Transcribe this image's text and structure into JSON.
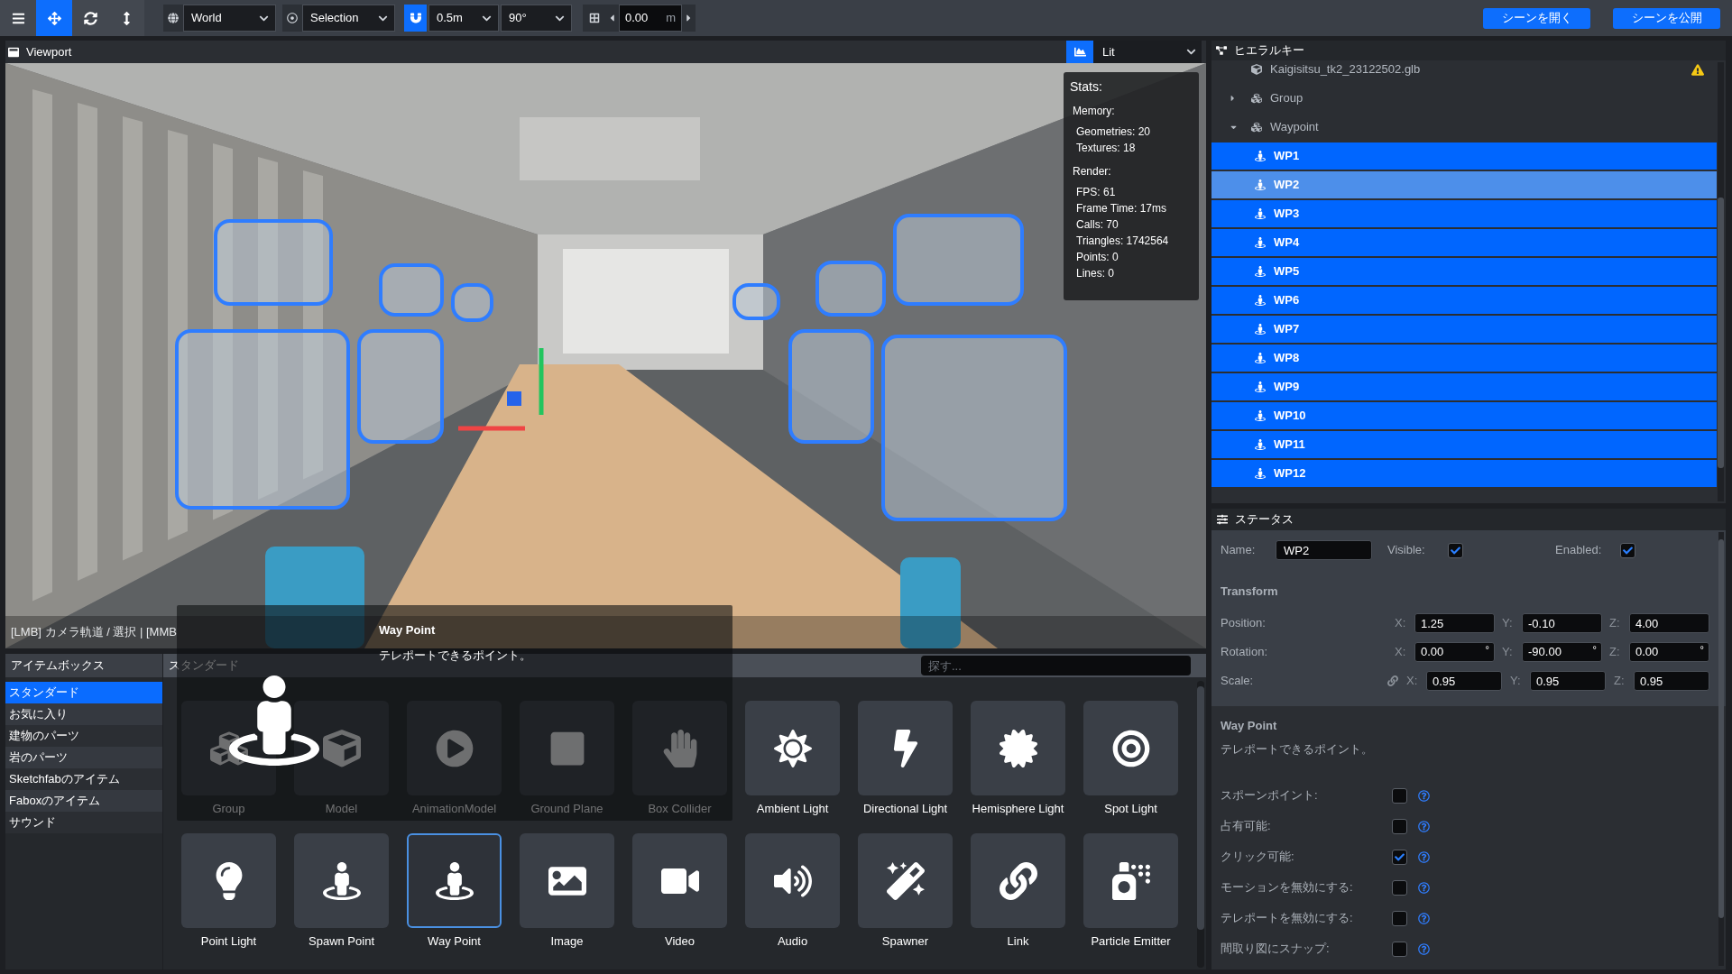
{
  "toolbar": {
    "tool_buttons": [
      {
        "kind": "menu",
        "selected": false
      },
      {
        "kind": "move",
        "selected": true
      },
      {
        "kind": "rotate",
        "selected": false
      },
      {
        "kind": "scale",
        "selected": false
      }
    ],
    "space": {
      "value": "World"
    },
    "selection": {
      "value": "Selection"
    },
    "snap": {
      "on": true,
      "distance": "0.5m",
      "angle": "90°"
    },
    "grid": {
      "value": "0.00",
      "unit": "m"
    },
    "actions": [
      {
        "label": "シーンを開く"
      },
      {
        "label": "シーンを公開"
      }
    ]
  },
  "viewport": {
    "title": "Viewport",
    "stats_toggle": {
      "on": true
    },
    "shading": {
      "value": "Lit"
    },
    "stats": {
      "title": "Stats:",
      "sections": [
        {
          "heading": "Memory:",
          "lines": [
            "Geometries: 20",
            "Textures: 18"
          ]
        },
        {
          "heading": "Render:",
          "lines": [
            "FPS: 61",
            "Frame Time: 17ms",
            "Calls: 70",
            "Triangles: 1742564",
            "Points: 0",
            "Lines: 0"
          ]
        }
      ]
    },
    "status_text": "[LMB] カメラ軌道 / 選択 | [MMB"
  },
  "hierarchy": {
    "title": "ヒエラルキー",
    "items": [
      {
        "label": "Kaigisitsu_tk2_23122502.glb",
        "kind": "model",
        "warning": true,
        "selected": false
      },
      {
        "label": "Group",
        "kind": "group",
        "expanded": false,
        "selected": false
      },
      {
        "label": "Waypoint",
        "kind": "group",
        "expanded": true,
        "selected": false,
        "children": [
          {
            "label": "WP1",
            "kind": "waypoint",
            "selected": true,
            "active": false
          },
          {
            "label": "WP2",
            "kind": "waypoint",
            "selected": true,
            "active": true
          },
          {
            "label": "WP3",
            "kind": "waypoint",
            "selected": true,
            "active": false
          },
          {
            "label": "WP4",
            "kind": "waypoint",
            "selected": true,
            "active": false
          },
          {
            "label": "WP5",
            "kind": "waypoint",
            "selected": true,
            "active": false
          },
          {
            "label": "WP6",
            "kind": "waypoint",
            "selected": true,
            "active": false
          },
          {
            "label": "WP7",
            "kind": "waypoint",
            "selected": true,
            "active": false
          },
          {
            "label": "WP8",
            "kind": "waypoint",
            "selected": true,
            "active": false
          },
          {
            "label": "WP9",
            "kind": "waypoint",
            "selected": true,
            "active": false
          },
          {
            "label": "WP10",
            "kind": "waypoint",
            "selected": true,
            "active": false
          },
          {
            "label": "WP11",
            "kind": "waypoint",
            "selected": true,
            "active": false
          },
          {
            "label": "WP12",
            "kind": "waypoint",
            "selected": true,
            "active": false
          }
        ]
      }
    ]
  },
  "status_panel": {
    "title": "ステータス",
    "name": {
      "label": "Name:",
      "value": "WP2"
    },
    "visible": {
      "label": "Visible:",
      "checked": true
    },
    "enabled": {
      "label": "Enabled:",
      "checked": true
    },
    "transform": {
      "title": "Transform",
      "rows": [
        {
          "label": "Position:",
          "fields": [
            {
              "axis": "X:",
              "value": "1.25"
            },
            {
              "axis": "Y:",
              "value": "-0.10"
            },
            {
              "axis": "Z:",
              "value": "4.00"
            }
          ]
        },
        {
          "label": "Rotation:",
          "fields": [
            {
              "axis": "X:",
              "value": "0.00",
              "unit": "°"
            },
            {
              "axis": "Y:",
              "value": "-90.00",
              "unit": "°"
            },
            {
              "axis": "Z:",
              "value": "0.00",
              "unit": "°"
            }
          ]
        },
        {
          "label": "Scale:",
          "linked": true,
          "fields": [
            {
              "axis": "X:",
              "value": "0.95"
            },
            {
              "axis": "Y:",
              "value": "0.95"
            },
            {
              "axis": "Z:",
              "value": "0.95"
            }
          ]
        }
      ]
    },
    "component": {
      "title": "Way Point",
      "description": "テレポートできるポイント。",
      "options": [
        {
          "label": "スポーンポイント:",
          "checked": false
        },
        {
          "label": "占有可能:",
          "checked": false
        },
        {
          "label": "クリック可能:",
          "checked": true
        },
        {
          "label": "モーションを無効にする:",
          "checked": false
        },
        {
          "label": "テレポートを無効にする:",
          "checked": false
        },
        {
          "label": "間取り図にスナップ:",
          "checked": false
        }
      ]
    }
  },
  "item_box": {
    "title": "アイテムボックス",
    "categories": [
      {
        "label": "スタンダード",
        "selected": true
      },
      {
        "label": "お気に入り",
        "selected": false
      },
      {
        "label": "建物のパーツ",
        "selected": false
      },
      {
        "label": "岩のパーツ",
        "selected": false
      },
      {
        "label": "Sketchfabのアイテム",
        "selected": false
      },
      {
        "label": "Faboxのアイテム",
        "selected": false
      },
      {
        "label": "サウンド",
        "selected": false
      }
    ],
    "section_title": "スタンダード",
    "search": {
      "placeholder": "探す..."
    },
    "items": [
      {
        "label": "Group",
        "kind": "group",
        "selected": false
      },
      {
        "label": "Model",
        "kind": "model",
        "selected": false
      },
      {
        "label": "AnimationModel",
        "kind": "animation_model",
        "selected": false
      },
      {
        "label": "Ground Plane",
        "kind": "ground_plane",
        "selected": false
      },
      {
        "label": "Box Collider",
        "kind": "box_collider",
        "selected": false
      },
      {
        "label": "Ambient Light",
        "kind": "ambient_light",
        "selected": false
      },
      {
        "label": "Directional Light",
        "kind": "directional_light",
        "selected": false
      },
      {
        "label": "Hemisphere Light",
        "kind": "hemisphere_light",
        "selected": false
      },
      {
        "label": "Spot Light",
        "kind": "spot_light",
        "selected": false
      },
      {
        "label": "Point Light",
        "kind": "point_light",
        "selected": false
      },
      {
        "label": "Spawn Point",
        "kind": "spawn_point",
        "selected": false
      },
      {
        "label": "Way Point",
        "kind": "way_point",
        "selected": true
      },
      {
        "label": "Image",
        "kind": "image",
        "selected": false
      },
      {
        "label": "Video",
        "kind": "video",
        "selected": false
      },
      {
        "label": "Audio",
        "kind": "audio",
        "selected": false
      },
      {
        "label": "Spawner",
        "kind": "spawner",
        "selected": false
      },
      {
        "label": "Link",
        "kind": "link",
        "selected": false
      },
      {
        "label": "Particle Emitter",
        "kind": "particle_emitter",
        "selected": false
      }
    ]
  },
  "tooltip": {
    "kind": "way_point",
    "title": "Way Point",
    "description": "テレポートできるポイント。"
  }
}
